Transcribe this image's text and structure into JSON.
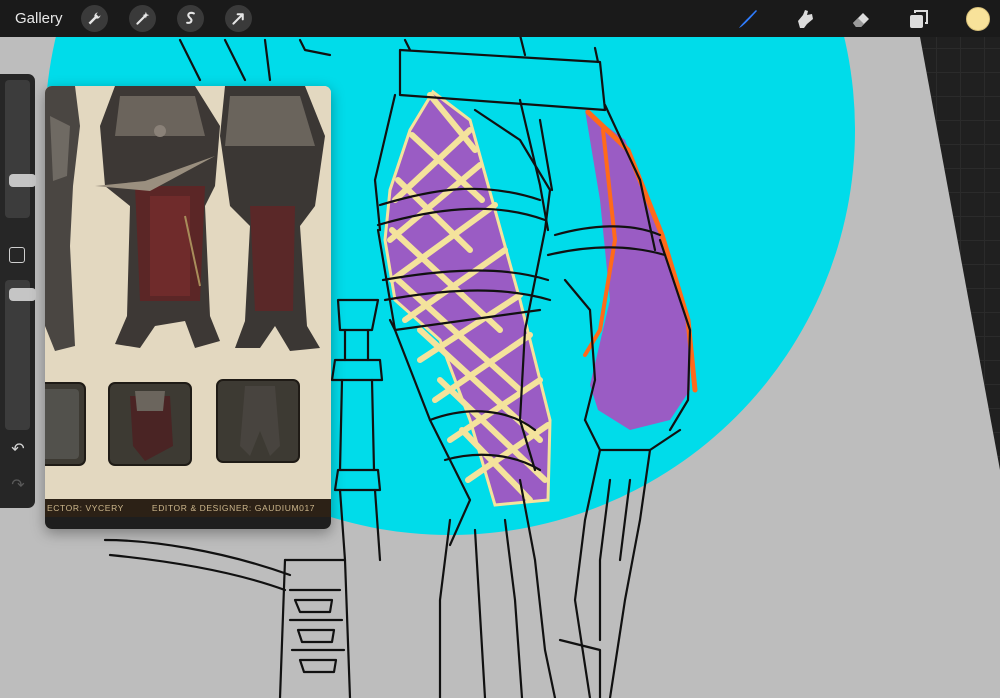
{
  "toolbar": {
    "gallery_label": "Gallery",
    "left_tools": [
      {
        "name": "actions",
        "icon": "wrench-icon"
      },
      {
        "name": "adjustments",
        "icon": "magic-wand-icon"
      },
      {
        "name": "selection",
        "icon": "selection-s-icon"
      },
      {
        "name": "transform",
        "icon": "arrow-cursor-icon"
      }
    ],
    "right_tools": [
      {
        "name": "brush",
        "icon": "brush-icon",
        "active": true
      },
      {
        "name": "smudge",
        "icon": "smudge-finger-icon"
      },
      {
        "name": "eraser",
        "icon": "eraser-icon"
      },
      {
        "name": "layers",
        "icon": "layers-icon"
      }
    ],
    "active_color": "#f8e29a"
  },
  "sidebar": {
    "brush_size_level": 0.68,
    "opacity_level": 0.94,
    "buttons": [
      "modify-icon",
      "undo-icon",
      "redo-icon"
    ]
  },
  "reference": {
    "credit_left": "ECTOR: VYCERY",
    "credit_right": "EDITOR & DESIGNER: GAUDIUM017"
  },
  "colors": {
    "circle": "#00d9ea",
    "canvas_bg": "#bdbdbd",
    "purple": "#9a5cc4",
    "yellow": "#f6e6a0",
    "orange": "#ff6a1a",
    "accent_brush": "#2f7dff"
  }
}
